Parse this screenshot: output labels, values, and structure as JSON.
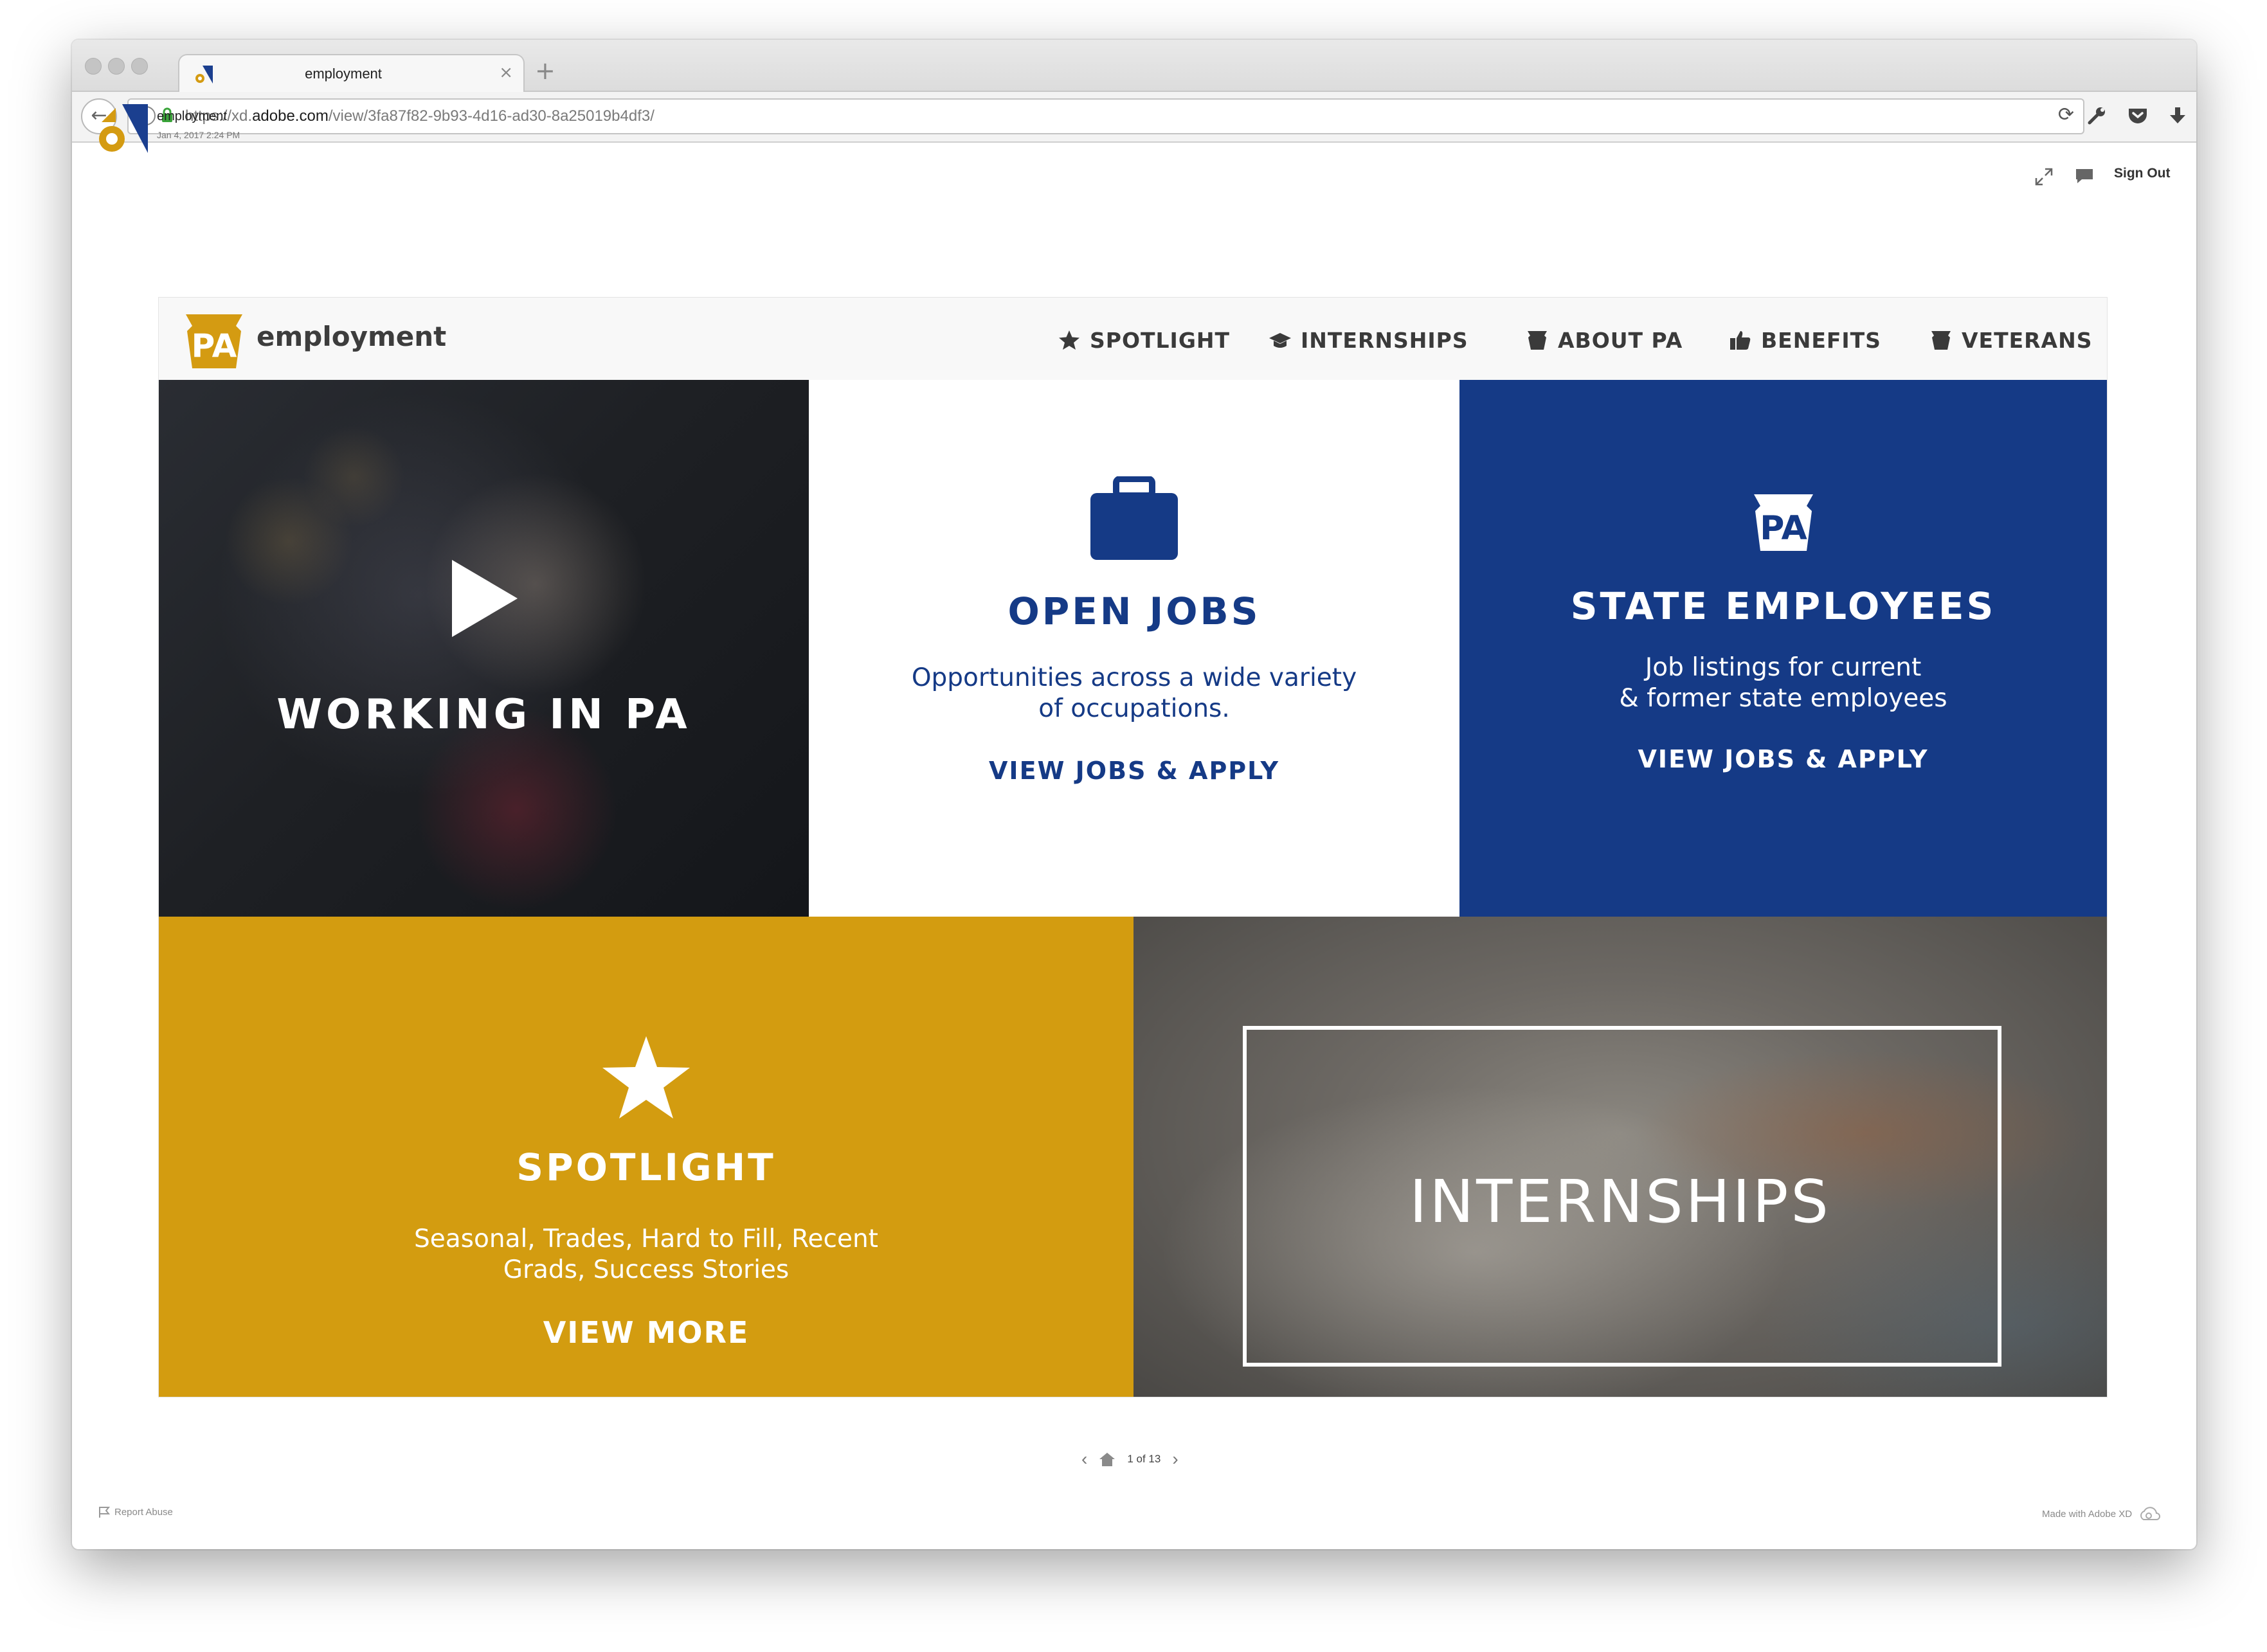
{
  "browser": {
    "tab_title": "employment",
    "url_prefix": "https://xd.",
    "url_host": "adobe.com",
    "url_path": "/view/3fa87f82-9b93-4d16-ad30-8a25019b4df3/",
    "tab_close": "×",
    "new_tab": "+"
  },
  "xd": {
    "doc_title": "employment",
    "doc_date": "Jan 4, 2017 2:24 PM",
    "sign_out": "Sign Out"
  },
  "site": {
    "logo_text": "PA",
    "brand": "employment",
    "nav": [
      {
        "label": "SPOTLIGHT",
        "icon": "star-icon"
      },
      {
        "label": "INTERNSHIPS",
        "icon": "graduation-cap-icon"
      },
      {
        "label": "ABOUT PA",
        "icon": "keystone-icon"
      },
      {
        "label": "BENEFITS",
        "icon": "thumbs-up-icon"
      },
      {
        "label": "VETERANS",
        "icon": "keystone-icon"
      }
    ]
  },
  "tiles": {
    "working": {
      "title": "WORKING IN PA",
      "icon": "play-icon"
    },
    "open_jobs": {
      "title": "OPEN JOBS",
      "line1": "Opportunities across a wide variety",
      "line2": "of occupations.",
      "cta": "VIEW JOBS & APPLY",
      "icon": "briefcase-icon"
    },
    "state": {
      "title": "STATE EMPLOYEES",
      "line1": "Job listings for current",
      "line2": "& former state employees",
      "cta": "VIEW JOBS & APPLY",
      "logo_text": "PA"
    },
    "spotlight": {
      "title": "SPOTLIGHT",
      "line1": "Seasonal, Trades, Hard to Fill, Recent",
      "line2": "Grads, Success Stories",
      "cta": "VIEW MORE",
      "icon": "star-icon"
    },
    "internships": {
      "title": "INTERNSHIPS"
    }
  },
  "footer": {
    "page_label": "1 of 13",
    "report": "Report Abuse",
    "made_with": "Made with Adobe XD"
  },
  "colors": {
    "navy": "#153a86",
    "gold": "#d39c10",
    "text_dark": "#3a3a3a"
  }
}
